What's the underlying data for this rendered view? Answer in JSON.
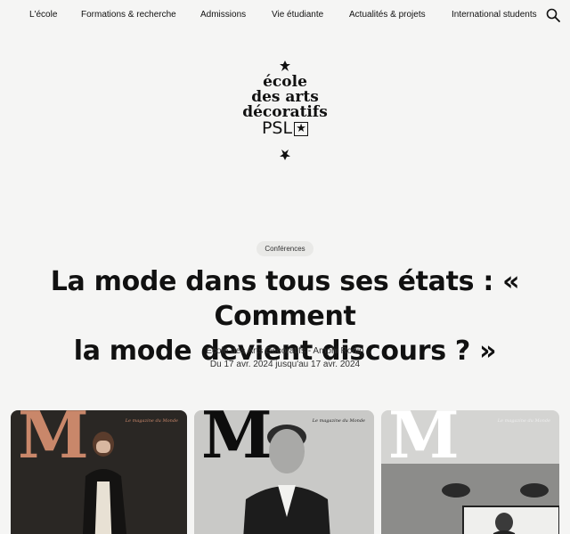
{
  "nav": {
    "items": [
      "L'école",
      "Formations & recherche",
      "Admissions",
      "Vie étudiante",
      "Actualités & projets",
      "International students"
    ],
    "search_icon": "search-icon"
  },
  "logo": {
    "line1": "école",
    "line2": "des arts",
    "line3": "décoratifs",
    "psl": "PSL"
  },
  "event": {
    "tag": "Conférences",
    "title_line1": "La mode dans tous ses états : « Comment",
    "title_line2": "la mode devient discours ? »",
    "location": "École des Arts Décoratifs - Amphi Rodin",
    "dates": "Du 17 avr. 2024 jusqu'au 17 avr. 2024"
  },
  "cards": [
    {
      "masthead": "M",
      "subtitle": "Le magazine du Monde"
    },
    {
      "masthead": "M",
      "subtitle": "Le magazine du Monde"
    },
    {
      "masthead": "M",
      "subtitle": "Le magazine du Monde"
    }
  ]
}
